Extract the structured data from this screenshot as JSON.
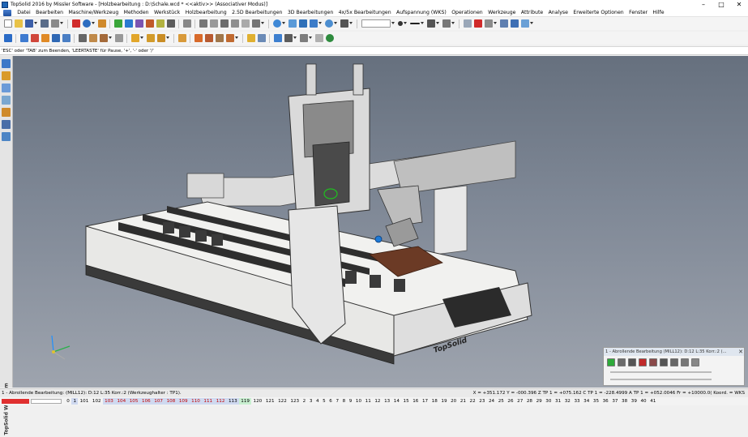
{
  "window": {
    "title": "TopSolid 2016 by Missler Software - [Holzbearbeitung : D:\\Schale.wcd * <<aktiv>> (Associativer Modus)]",
    "minimize": "–",
    "maximize": "□",
    "close": "✕"
  },
  "menu": [
    "Datei",
    "Bearbeiten",
    "Maschine/Werkzeug",
    "Methoden",
    "Werkstück",
    "Holzbearbeitung",
    "2.5D Bearbeitungen",
    "3D Bearbeitungen",
    "4x/5x Bearbeitungen",
    "Aufspannung (WKS)",
    "Operationen",
    "Werkzeuge",
    "Attribute",
    "Analyse",
    "Erweiterte Optionen",
    "Fenster",
    "Hilfe"
  ],
  "prompt": "'ESC' oder 'TAB' zum Beenden, 'LEERTASTE' für Pause, '+', '-' oder '/'",
  "side_label": "TopSolid  WoodCam",
  "viewport": {
    "brand": "TopSolid",
    "model_colors": {
      "frame": "#f1f1ef",
      "dark": "#3a3a3a",
      "gantry": "#e4e4e4",
      "workpiece": "#6b3a25",
      "accent": "#1e7ad6"
    }
  },
  "sim_panel": {
    "title": "1 - Abrollende Bearbeitung    (MILL12): D:12  L:35  Korr.:2  (...",
    "close": "✕"
  },
  "status": {
    "left": "1 - Abrollende Bearbeitung:    (MILL12): D:12  L:35  Korr.:2  (Werkzeughalter : TP1).",
    "right": "X = +351.172  Y = -000.396  Z TP 1 = +075.162  C TP 1 = -228.4999  A TP 1 = +052.0046  Fr = +10000.0(  Koord. = WKS"
  },
  "numbers": [
    "0",
    "1",
    "101",
    "102",
    "103",
    "104",
    "105",
    "106",
    "107",
    "108",
    "109",
    "110",
    "111",
    "112",
    "113",
    "119",
    "120",
    "121",
    "122",
    "123",
    "2",
    "3",
    "4",
    "5",
    "6",
    "7",
    "8",
    "9",
    "10",
    "11",
    "12",
    "13",
    "14",
    "15",
    "16",
    "17",
    "18",
    "19",
    "20",
    "21",
    "22",
    "23",
    "24",
    "25",
    "26",
    "27",
    "28",
    "29",
    "30",
    "31",
    "32",
    "33",
    "34",
    "35",
    "36",
    "37",
    "38",
    "39",
    "40",
    "41"
  ]
}
